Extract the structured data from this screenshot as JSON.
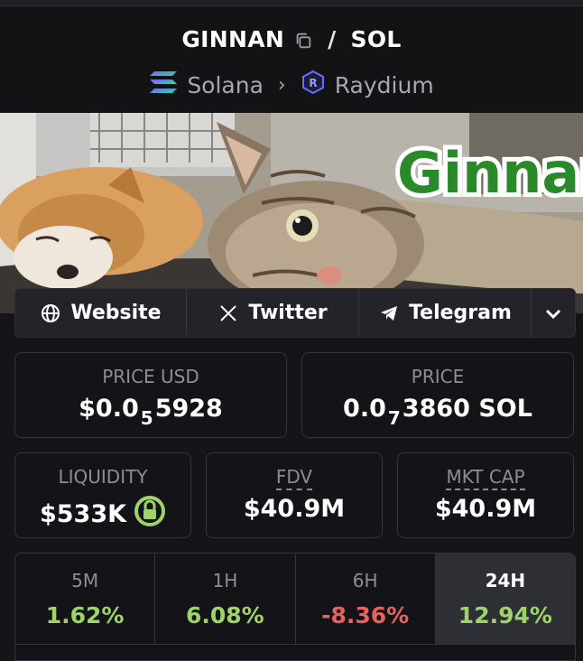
{
  "header": {
    "token": "GINNAN",
    "separator": "/",
    "quote": "SOL",
    "chain": "Solana",
    "dex": "Raydium"
  },
  "banner": {
    "text": "Ginnan"
  },
  "links": [
    {
      "label": "Website",
      "icon": "globe-icon"
    },
    {
      "label": "Twitter",
      "icon": "x-icon"
    },
    {
      "label": "Telegram",
      "icon": "telegram-icon"
    }
  ],
  "stats": {
    "price_usd_label": "PRICE USD",
    "price_usd_prefix": "$0.0",
    "price_usd_zeros": "5",
    "price_usd_digits": "5928",
    "price_label": "PRICE",
    "price_prefix": "0.0",
    "price_zeros": "7",
    "price_digits": "3860 SOL",
    "liquidity_label": "LIQUIDITY",
    "liquidity_value": "$533K",
    "fdv_label": "FDV",
    "fdv_value": "$40.9M",
    "mktcap_label": "MKT CAP",
    "mktcap_value": "$40.9M"
  },
  "changes": [
    {
      "period": "5M",
      "value": "1.62%",
      "color": "#9ed36a"
    },
    {
      "period": "1H",
      "value": "6.08%",
      "color": "#9ed36a"
    },
    {
      "period": "6H",
      "value": "-8.36%",
      "color": "#e5635c"
    },
    {
      "period": "24H",
      "value": "12.94%",
      "color": "#9ed36a",
      "active": true
    }
  ],
  "colors": {
    "positive": "#9ed36a",
    "negative": "#e5635c",
    "lock": "#9ed36a"
  }
}
